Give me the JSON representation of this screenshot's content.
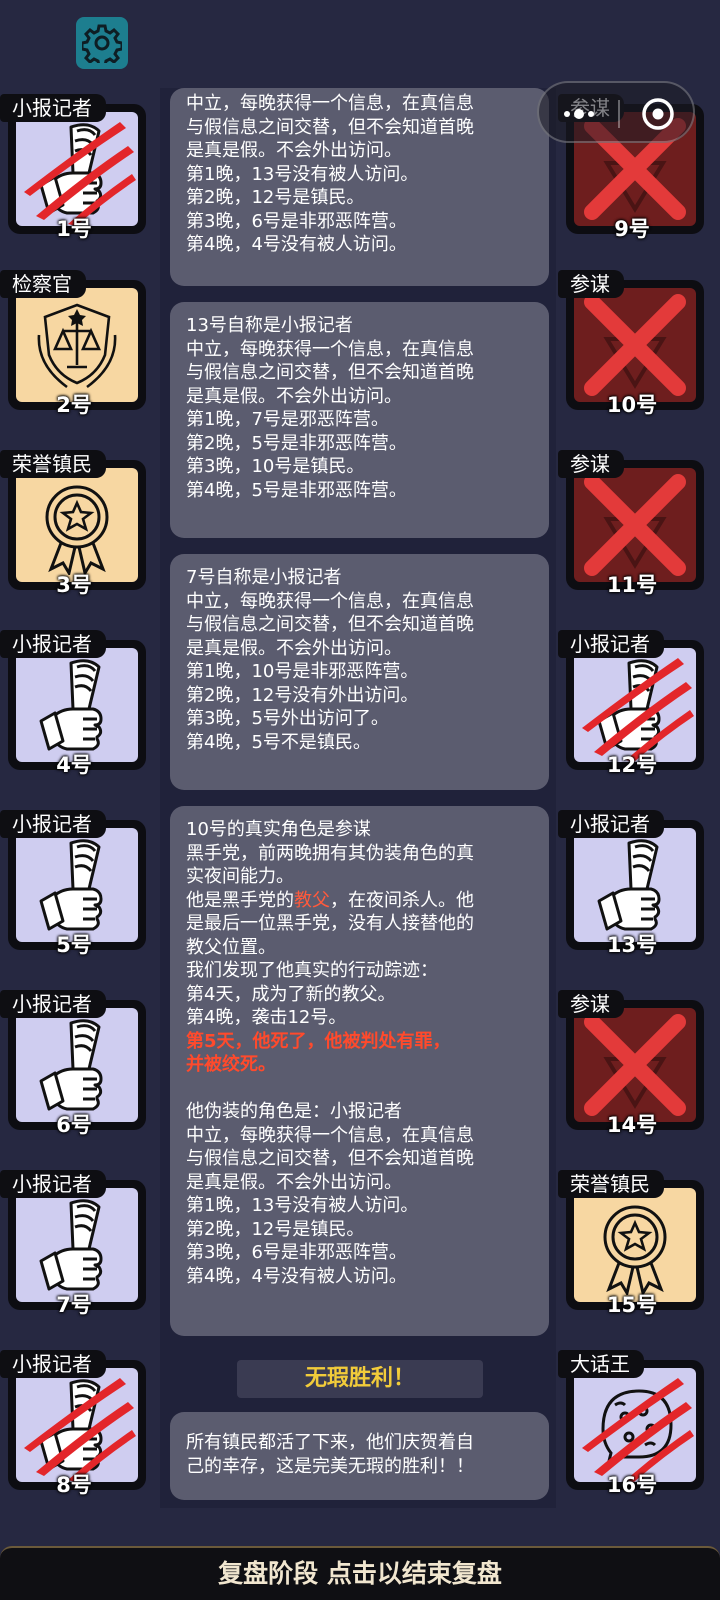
{
  "icons": {
    "settings": "gear-icon",
    "more": "more-dots-icon",
    "close": "target-close-icon",
    "reporter": "newspaper-hand-icon",
    "prosecutor": "justice-shield-icon",
    "honored": "medal-icon",
    "liar": "speech-bubble-icon",
    "conspirator": "red-x-icon",
    "slain": "claw-scratch-icon"
  },
  "colors": {
    "scratch": "#e3262a",
    "highlight": "#ff5a3c",
    "victory": "#f2cc3a"
  },
  "players_left": [
    {
      "role": "小报记者",
      "num": "1号",
      "type": "reporter",
      "slain": true
    },
    {
      "role": "检察官",
      "num": "2号",
      "type": "prosecutor",
      "slain": false
    },
    {
      "role": "荣誉镇民",
      "num": "3号",
      "type": "honored",
      "slain": false
    },
    {
      "role": "小报记者",
      "num": "4号",
      "type": "reporter",
      "slain": false
    },
    {
      "role": "小报记者",
      "num": "5号",
      "type": "reporter",
      "slain": false
    },
    {
      "role": "小报记者",
      "num": "6号",
      "type": "reporter",
      "slain": false
    },
    {
      "role": "小报记者",
      "num": "7号",
      "type": "reporter",
      "slain": false
    },
    {
      "role": "小报记者",
      "num": "8号",
      "type": "reporter",
      "slain": true
    }
  ],
  "players_right": [
    {
      "role": "参谋",
      "num": "9号",
      "type": "conspirator",
      "slain": false
    },
    {
      "role": "参谋",
      "num": "10号",
      "type": "conspirator",
      "slain": false
    },
    {
      "role": "参谋",
      "num": "11号",
      "type": "conspirator",
      "slain": false
    },
    {
      "role": "小报记者",
      "num": "12号",
      "type": "reporter",
      "slain": true
    },
    {
      "role": "小报记者",
      "num": "13号",
      "type": "reporter",
      "slain": false
    },
    {
      "role": "参谋",
      "num": "14号",
      "type": "conspirator",
      "slain": false
    },
    {
      "role": "荣誉镇民",
      "num": "15号",
      "type": "honored",
      "slain": false
    },
    {
      "role": "大话王",
      "num": "16号",
      "type": "liar",
      "slain": true
    }
  ],
  "panels": [
    {
      "lines": [
        "中立，每晚获得一个信息，在真信息",
        "与假信息之间交替，但不会知道首晚",
        "是真是假。不会外出访问。",
        "第1晚，13号没有被人访问。",
        "第2晚，12号是镇民。",
        "第3晚，6号是非邪恶阵营。",
        "第4晚，4号没有被人访问。"
      ]
    },
    {
      "lines": [
        "13号自称是小报记者",
        "中立，每晚获得一个信息，在真信息",
        "与假信息之间交替，但不会知道首晚",
        "是真是假。不会外出访问。",
        "第1晚，7号是邪恶阵营。",
        "第2晚，5号是非邪恶阵营。",
        "第3晚，10号是镇民。",
        "第4晚，5号是非邪恶阵营。"
      ]
    },
    {
      "lines": [
        "7号自称是小报记者",
        "中立，每晚获得一个信息，在真信息",
        "与假信息之间交替，但不会知道首晚",
        "是真是假。不会外出访问。",
        "第1晚，10号是非邪恶阵营。",
        "第2晚，12号没有外出访问。",
        "第3晚，5号外出访问了。",
        "第4晚，5号不是镇民。"
      ]
    },
    {
      "a": [
        "10号的真实角色是参谋",
        "黑手党，前两晚拥有其伪装角色的真",
        "实夜间能力。"
      ],
      "b_pre": "他是黑手党的",
      "b_hl": "教父",
      "b_post": "，在夜间杀人。他",
      "c": [
        "是最后一位黑手党，没有人接替他的",
        "教父位置。",
        "我们发现了他真实的行动踪迹：",
        "第4天，成为了新的教父。",
        "第4晚，袭击12号。"
      ],
      "d": [
        "第5天，他死了，他被判处有罪，",
        "并被绞死。"
      ],
      "e": [
        "他伪装的角色是：小报记者",
        "中立，每晚获得一个信息，在真信息",
        "与假信息之间交替，但不会知道首晚",
        "是真是假。不会外出访问。",
        "第1晚，13号没有被人访问。",
        "第2晚，12号是镇民。",
        "第3晚，6号是非邪恶阵营。",
        "第4晚，4号没有被人访问。"
      ]
    },
    {
      "lines": [
        "所有镇民都活了下来，他们庆贺着自",
        "己的幸存，这是完美无瑕的胜利！！"
      ]
    }
  ],
  "victory": "无瑕胜利！",
  "bottom": "复盘阶段 点击以结束复盘"
}
